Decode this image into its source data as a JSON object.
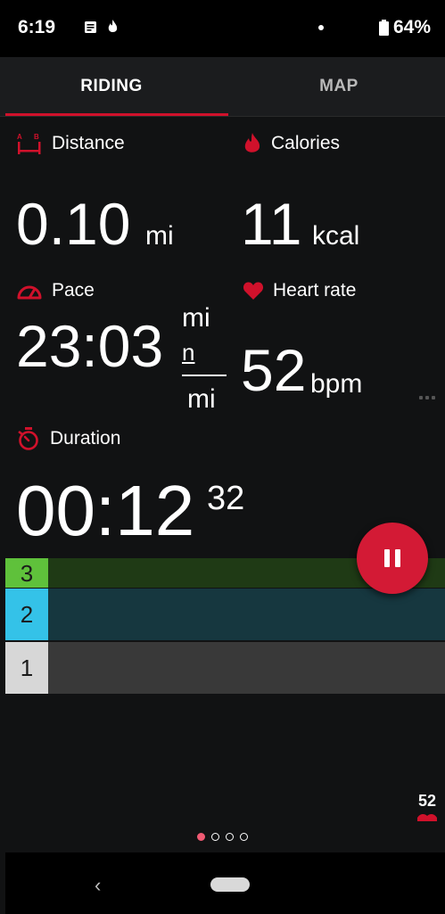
{
  "status_bar": {
    "time": "6:19",
    "battery_percent": "64%",
    "icons": [
      "message-icon",
      "flame-icon",
      "dot-icon",
      "battery-icon"
    ]
  },
  "tabs": [
    {
      "label": "RIDING",
      "active": true
    },
    {
      "label": "MAP",
      "active": false
    }
  ],
  "metrics": {
    "distance": {
      "label": "Distance",
      "value": "0.10",
      "unit": "mi",
      "icon": "distance-icon"
    },
    "calories": {
      "label": "Calories",
      "value": "11",
      "unit": "kcal",
      "icon": "flame-icon"
    },
    "pace": {
      "label": "Pace",
      "value": "23:03",
      "unit_top": "mi",
      "unit_mid": "n",
      "unit_bottom": "mi",
      "icon": "speedometer-icon"
    },
    "heart_rate": {
      "label": "Heart rate",
      "value": "52",
      "unit": "bpm",
      "icon": "heart-icon"
    },
    "duration": {
      "label": "Duration",
      "value": "00:12",
      "seconds": "32",
      "icon": "stopwatch-icon"
    }
  },
  "zones": [
    {
      "num": "3",
      "color": "#5fc13b",
      "bar_color": "#1f3a15"
    },
    {
      "num": "2",
      "color": "#34c2e8",
      "bar_color": "#16373f"
    },
    {
      "num": "1",
      "color": "#d7d7d7",
      "bar_color": "#393939"
    }
  ],
  "mini_heart_rate": "52",
  "pager": {
    "count": 4,
    "active_index": 0
  },
  "colors": {
    "accent": "#d0112b",
    "pause_button": "#d31a35"
  }
}
